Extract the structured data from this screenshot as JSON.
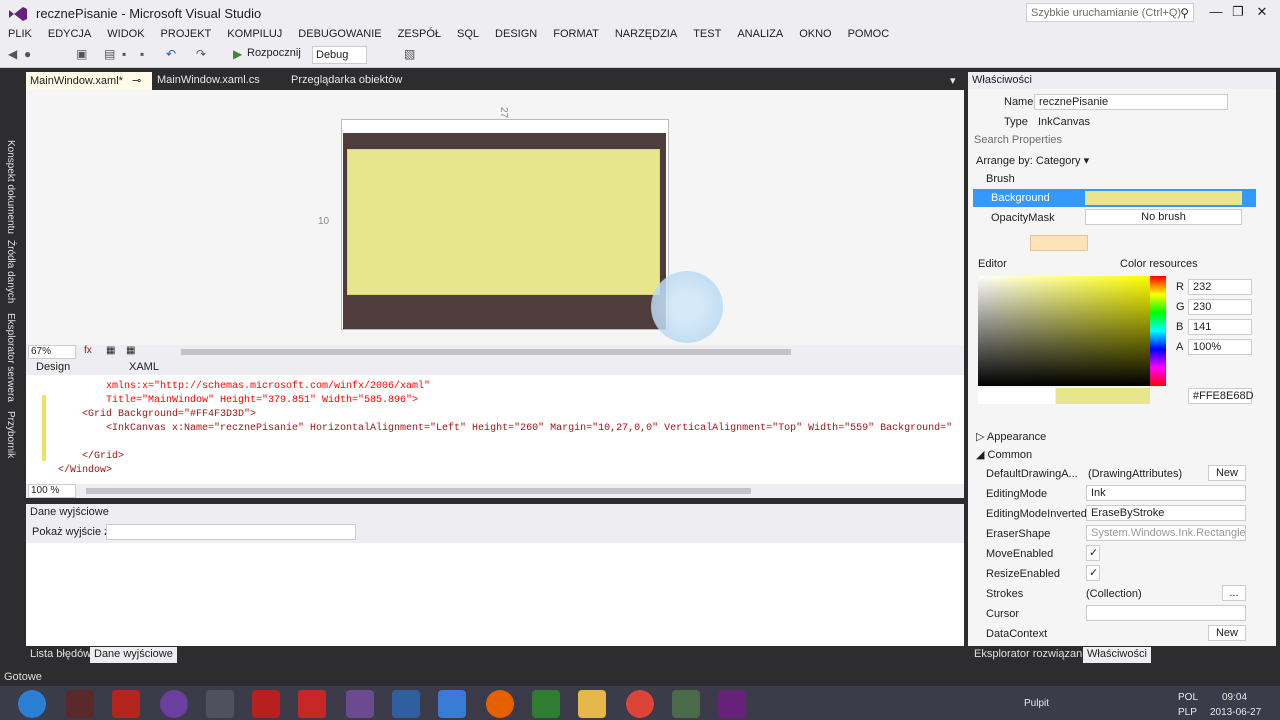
{
  "window": {
    "title": "recznePisanie - Microsoft Visual Studio",
    "quick_launch": "Szybkie uruchamianie (Ctrl+Q)",
    "min": "—",
    "max": "❐",
    "close": "✕"
  },
  "menu": [
    "PLIK",
    "EDYCJA",
    "WIDOK",
    "PROJEKT",
    "KOMPILUJ",
    "DEBUGOWANIE",
    "ZESPÓŁ",
    "SQL",
    "DESIGN",
    "FORMAT",
    "NARZĘDZIA",
    "TEST",
    "ANALIZA",
    "OKNO",
    "POMOC"
  ],
  "toolbar": {
    "start": "Rozpocznij",
    "config": "Debug"
  },
  "left_tabs": [
    "Konspekt dokumentu",
    "Źródła danych",
    "Eksplorator serwera",
    "Przybornik"
  ],
  "doc_tabs": [
    "MainWindow.xaml*",
    "MainWindow.xaml.cs",
    "Przeglądarka obiektów"
  ],
  "designer": {
    "zoom": "67%",
    "margin_left": "10",
    "margin_top": "27",
    "design_tab": "Design",
    "xaml_tab": "XAML"
  },
  "code": {
    "l1": "xmlns:x=\"http://schemas.microsoft.com/winfx/2006/xaml\"",
    "l2": "Title=\"MainWindow\" Height=\"379.851\" Width=\"585.896\">",
    "l3": "<Grid Background=\"#FF4F3D3D\">",
    "l4": "<InkCanvas x:Name=\"recznePisanie\" HorizontalAlignment=\"Left\" Height=\"260\" Margin=\"10,27,0,0\" VerticalAlignment=\"Top\" Width=\"559\" Background=\"",
    "l5": "</Grid>",
    "l6": "</Window>",
    "zoom": "100 %"
  },
  "output": {
    "title": "Dane wyjściowe",
    "show_label": "Pokaż wyjście z:"
  },
  "bottom_tabs": [
    "Lista błędów",
    "Dane wyjściowe"
  ],
  "props": {
    "title": "Właściwości",
    "name_label": "Name",
    "name_value": "recznePisanie",
    "type_label": "Type",
    "type_value": "InkCanvas",
    "search": "Search Properties",
    "arrange": "Arrange by: Category ▾",
    "brush": "Brush",
    "background": "Background",
    "opacity_mask": "OpacityMask",
    "no_brush": "No brush",
    "editor": "Editor",
    "color_resources": "Color resources",
    "r_label": "R",
    "r": "232",
    "g_label": "G",
    "g": "230",
    "b_label": "B",
    "b": "141",
    "a_label": "A",
    "a": "100%",
    "hex": "#FFE8E68D",
    "appearance": "Appearance",
    "common": "Common",
    "rows": [
      {
        "k": "DefaultDrawingA...",
        "v": "(DrawingAttributes)",
        "btn": "New"
      },
      {
        "k": "EditingMode",
        "v": "Ink"
      },
      {
        "k": "EditingModeInverted",
        "v": "EraseByStroke"
      },
      {
        "k": "EraserShape",
        "v": "System.Windows.Ink.RectangleSt..."
      },
      {
        "k": "MoveEnabled",
        "v": "✓"
      },
      {
        "k": "ResizeEnabled",
        "v": "✓"
      },
      {
        "k": "Strokes",
        "v": "(Collection)",
        "btn": "..."
      },
      {
        "k": "Cursor",
        "v": ""
      },
      {
        "k": "DataContext",
        "v": "",
        "btn": "New"
      }
    ]
  },
  "right_tabs": [
    "Eksplorator rozwiązania",
    "Właściwości"
  ],
  "status": "Gotowe",
  "taskbar": {
    "pulpit": "Pulpit",
    "lang1": "POL",
    "lang2": "PLP",
    "time": "09:04",
    "date": "2013-06-27"
  },
  "colors": {
    "canvas": "#e8e68d",
    "grid": "#4f3d3d",
    "accent": "#68217a"
  }
}
